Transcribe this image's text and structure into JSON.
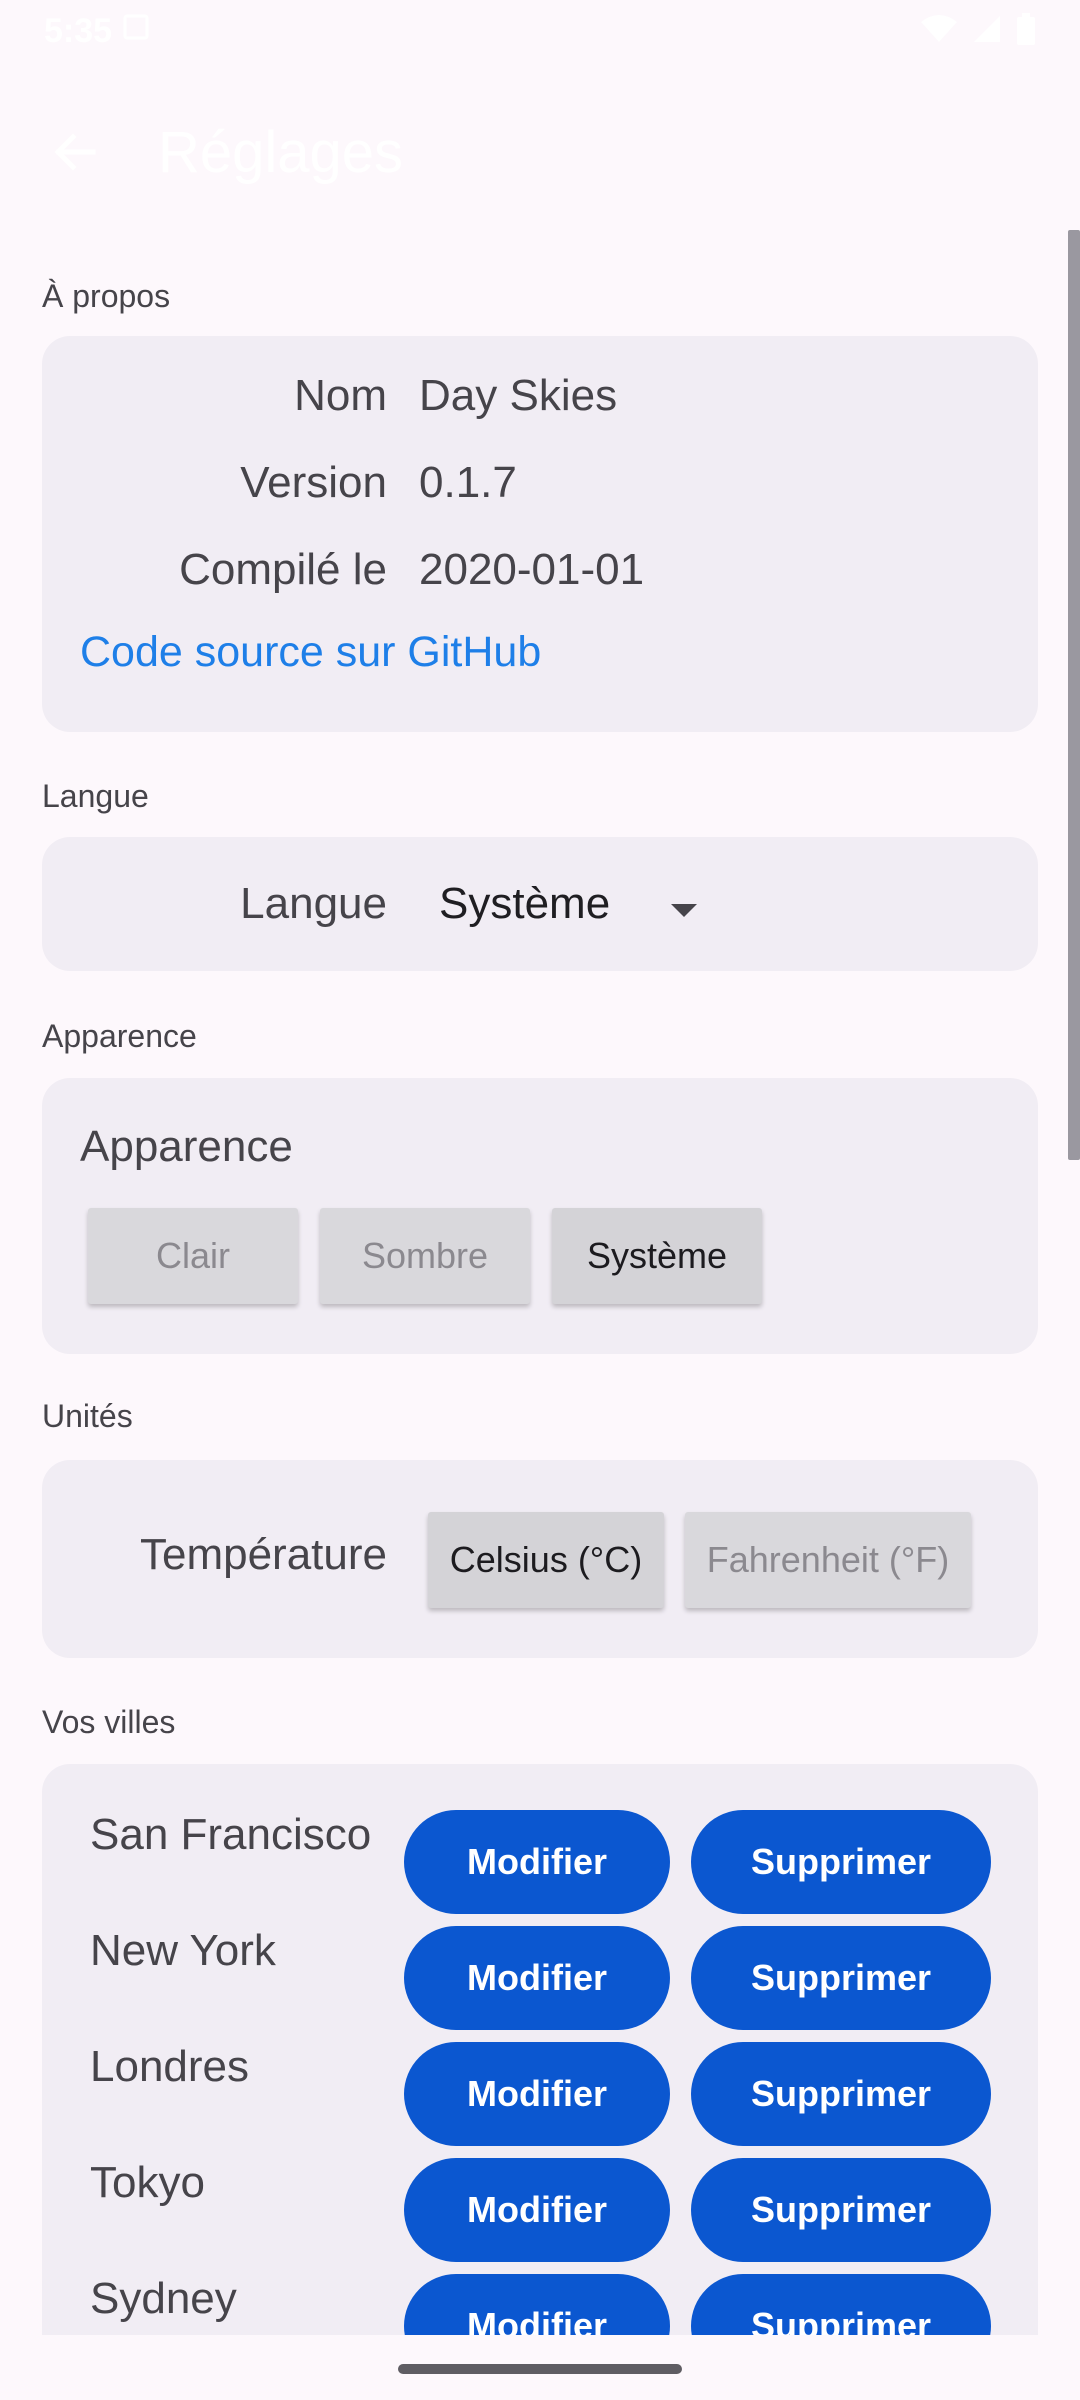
{
  "status": {
    "time": "5:35"
  },
  "app_bar": {
    "title": "Réglages"
  },
  "sections": {
    "about": {
      "label": "À propos",
      "rows": [
        {
          "key": "Nom",
          "value": "Day Skies"
        },
        {
          "key": "Version",
          "value": "0.1.7"
        },
        {
          "key": "Compilé le",
          "value": "2020-01-01"
        }
      ],
      "link": "Code source sur GitHub"
    },
    "language": {
      "label": "Langue",
      "field_label": "Langue",
      "selected": "Système"
    },
    "appearance": {
      "label": "Apparence",
      "heading": "Apparence",
      "options": [
        "Clair",
        "Sombre",
        "Système"
      ],
      "selected_index": 2
    },
    "units": {
      "label": "Unités",
      "field_label": "Température",
      "options": [
        "Celsius (°C)",
        "Fahrenheit (°F)"
      ],
      "selected_index": 0
    },
    "cities": {
      "label": "Vos villes",
      "edit_label": "Modifier",
      "delete_label": "Supprimer",
      "items": [
        "San Francisco",
        "New York",
        "Londres",
        "Tokyo",
        "Sydney"
      ]
    }
  },
  "colors": {
    "background": "#fdf8fc",
    "card": "#f1edf4",
    "accent_button": "#0b57d0",
    "link": "#1e7fe8"
  }
}
